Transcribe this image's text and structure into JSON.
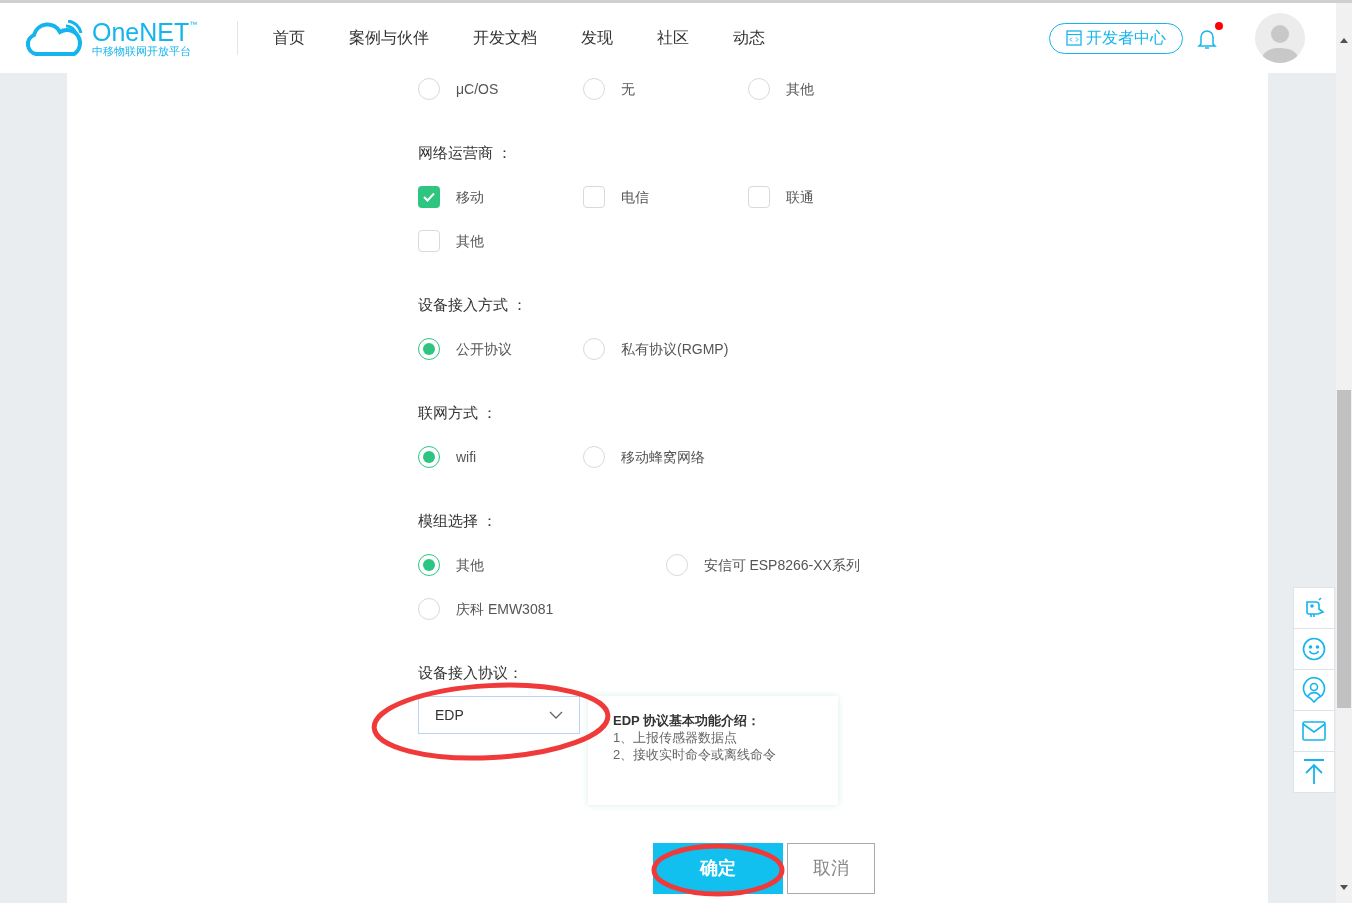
{
  "header": {
    "logo": {
      "name": "OneNET",
      "mark": "™",
      "subtitle": "中移物联网开放平台"
    },
    "nav": [
      {
        "label": "首页"
      },
      {
        "label": "案例与伙伴"
      },
      {
        "label": "开发文档"
      },
      {
        "label": "发现"
      },
      {
        "label": "社区"
      },
      {
        "label": "动态"
      }
    ],
    "dev_center_button": "开发者中心",
    "notification": {
      "unread": true
    }
  },
  "form": {
    "sections": [
      {
        "kind": "radio",
        "options": [
          {
            "label": "μC/OS",
            "selected": false
          },
          {
            "label": "无",
            "selected": false
          },
          {
            "label": "其他",
            "selected": false
          }
        ]
      },
      {
        "label": "网络运营商 ：",
        "kind": "checkbox",
        "options": [
          {
            "label": "移动",
            "checked": true
          },
          {
            "label": "电信",
            "checked": false
          },
          {
            "label": "联通",
            "checked": false
          },
          {
            "label": "其他",
            "checked": false
          }
        ]
      },
      {
        "label": "设备接入方式 ：",
        "kind": "radio",
        "options": [
          {
            "label": "公开协议",
            "selected": true
          },
          {
            "label": "私有协议(RGMP)",
            "selected": false
          }
        ]
      },
      {
        "label": "联网方式 ：",
        "kind": "radio",
        "options": [
          {
            "label": "wifi",
            "selected": true
          },
          {
            "label": "移动蜂窝网络",
            "selected": false
          }
        ]
      },
      {
        "label": "模组选择 ：",
        "kind": "radio",
        "options": [
          {
            "label": "其他",
            "selected": true
          },
          {
            "label": "安信可 ESP8266-XX系列",
            "selected": false
          },
          {
            "label": "庆科 EMW3081",
            "selected": false
          }
        ]
      }
    ],
    "protocol": {
      "label": "设备接入协议：",
      "value": "EDP",
      "info_title": "EDP 协议基本功能介绍：",
      "info_lines": [
        "1、上报传感器数据点",
        "2、接收实时命令或离线命令"
      ]
    },
    "buttons": {
      "confirm": "确定",
      "cancel": "取消"
    }
  }
}
